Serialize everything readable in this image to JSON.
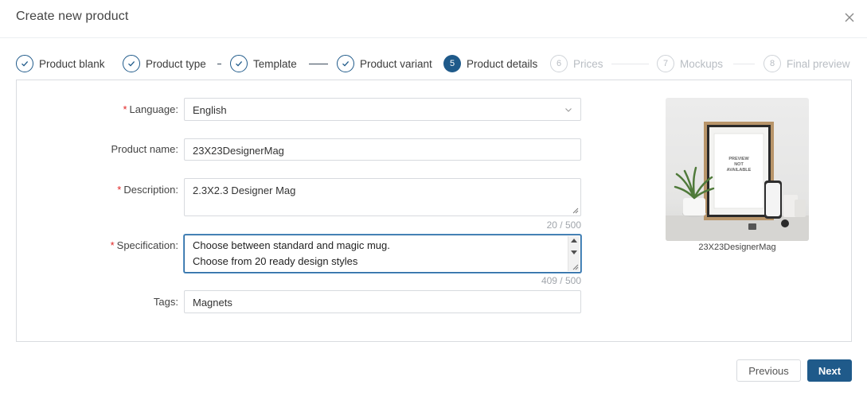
{
  "dialog": {
    "title": "Create new product"
  },
  "steps": [
    {
      "num": "1",
      "label": "Product blank",
      "state": "done"
    },
    {
      "num": "2",
      "label": "Product type",
      "state": "done"
    },
    {
      "num": "3",
      "label": "Template",
      "state": "done"
    },
    {
      "num": "4",
      "label": "Product variant",
      "state": "done"
    },
    {
      "num": "5",
      "label": "Product details",
      "state": "active"
    },
    {
      "num": "6",
      "label": "Prices",
      "state": "todo"
    },
    {
      "num": "7",
      "label": "Mockups",
      "state": "todo"
    },
    {
      "num": "8",
      "label": "Final preview",
      "state": "todo"
    }
  ],
  "form": {
    "language": {
      "label": "Language",
      "value": "English"
    },
    "product_name": {
      "label": "Product name",
      "value": "23X23DesignerMag"
    },
    "description": {
      "label": "Description",
      "value": "2.3X2.3 Designer Mag",
      "counter": "20 / 500"
    },
    "specification": {
      "label": "Specification",
      "lines": [
        "Choose between standard and magic mug.",
        "Choose from 20 ready design styles"
      ],
      "counter": "409 / 500"
    },
    "tags": {
      "label": "Tags",
      "value": "Magnets"
    }
  },
  "preview": {
    "caption": "23X23DesignerMag",
    "placeholder_lines": [
      "PREVIEW",
      "NOT",
      "AVAILABLE"
    ]
  },
  "footer": {
    "previous_label": "Previous",
    "next_label": "Next"
  },
  "colors": {
    "accent": "#1f5a8a",
    "required": "#e02424"
  }
}
